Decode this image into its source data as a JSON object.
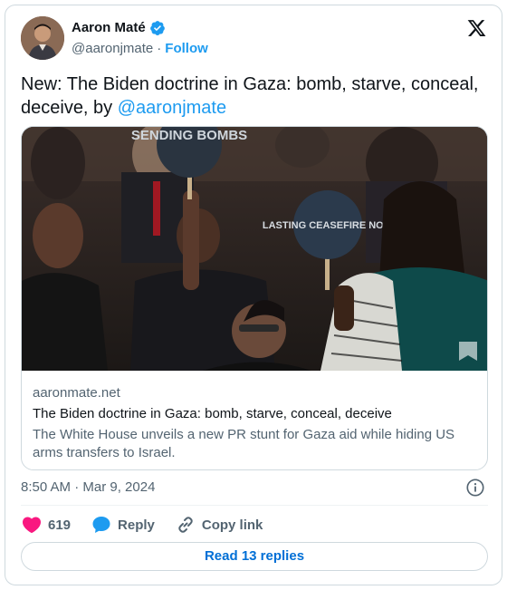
{
  "author": {
    "name": "Aaron Maté",
    "handle": "@aaronjmate",
    "separator": "·",
    "follow_label": "Follow"
  },
  "tweet": {
    "text": "New: The Biden doctrine in Gaza: bomb, starve, conceal, deceive, by ",
    "mention": "@aaronjmate"
  },
  "link_card": {
    "image_signs": [
      "SENDING BOMBS",
      "LASTING CEASEFIRE NOW"
    ],
    "domain": "aaronmate.net",
    "title": "The Biden doctrine in Gaza: bomb, starve, conceal, deceive",
    "description": "The White House unveils a new PR stunt for Gaza aid while hiding US arms transfers to Israel."
  },
  "meta": {
    "timestamp": "8:50 AM · Mar 9, 2024"
  },
  "actions": {
    "like_count": "619",
    "reply_label": "Reply",
    "copy_link_label": "Copy link"
  },
  "read_replies_label": "Read 13 replies",
  "colors": {
    "accent": "#1d9bf0",
    "like": "#f91880",
    "muted": "#536471"
  }
}
